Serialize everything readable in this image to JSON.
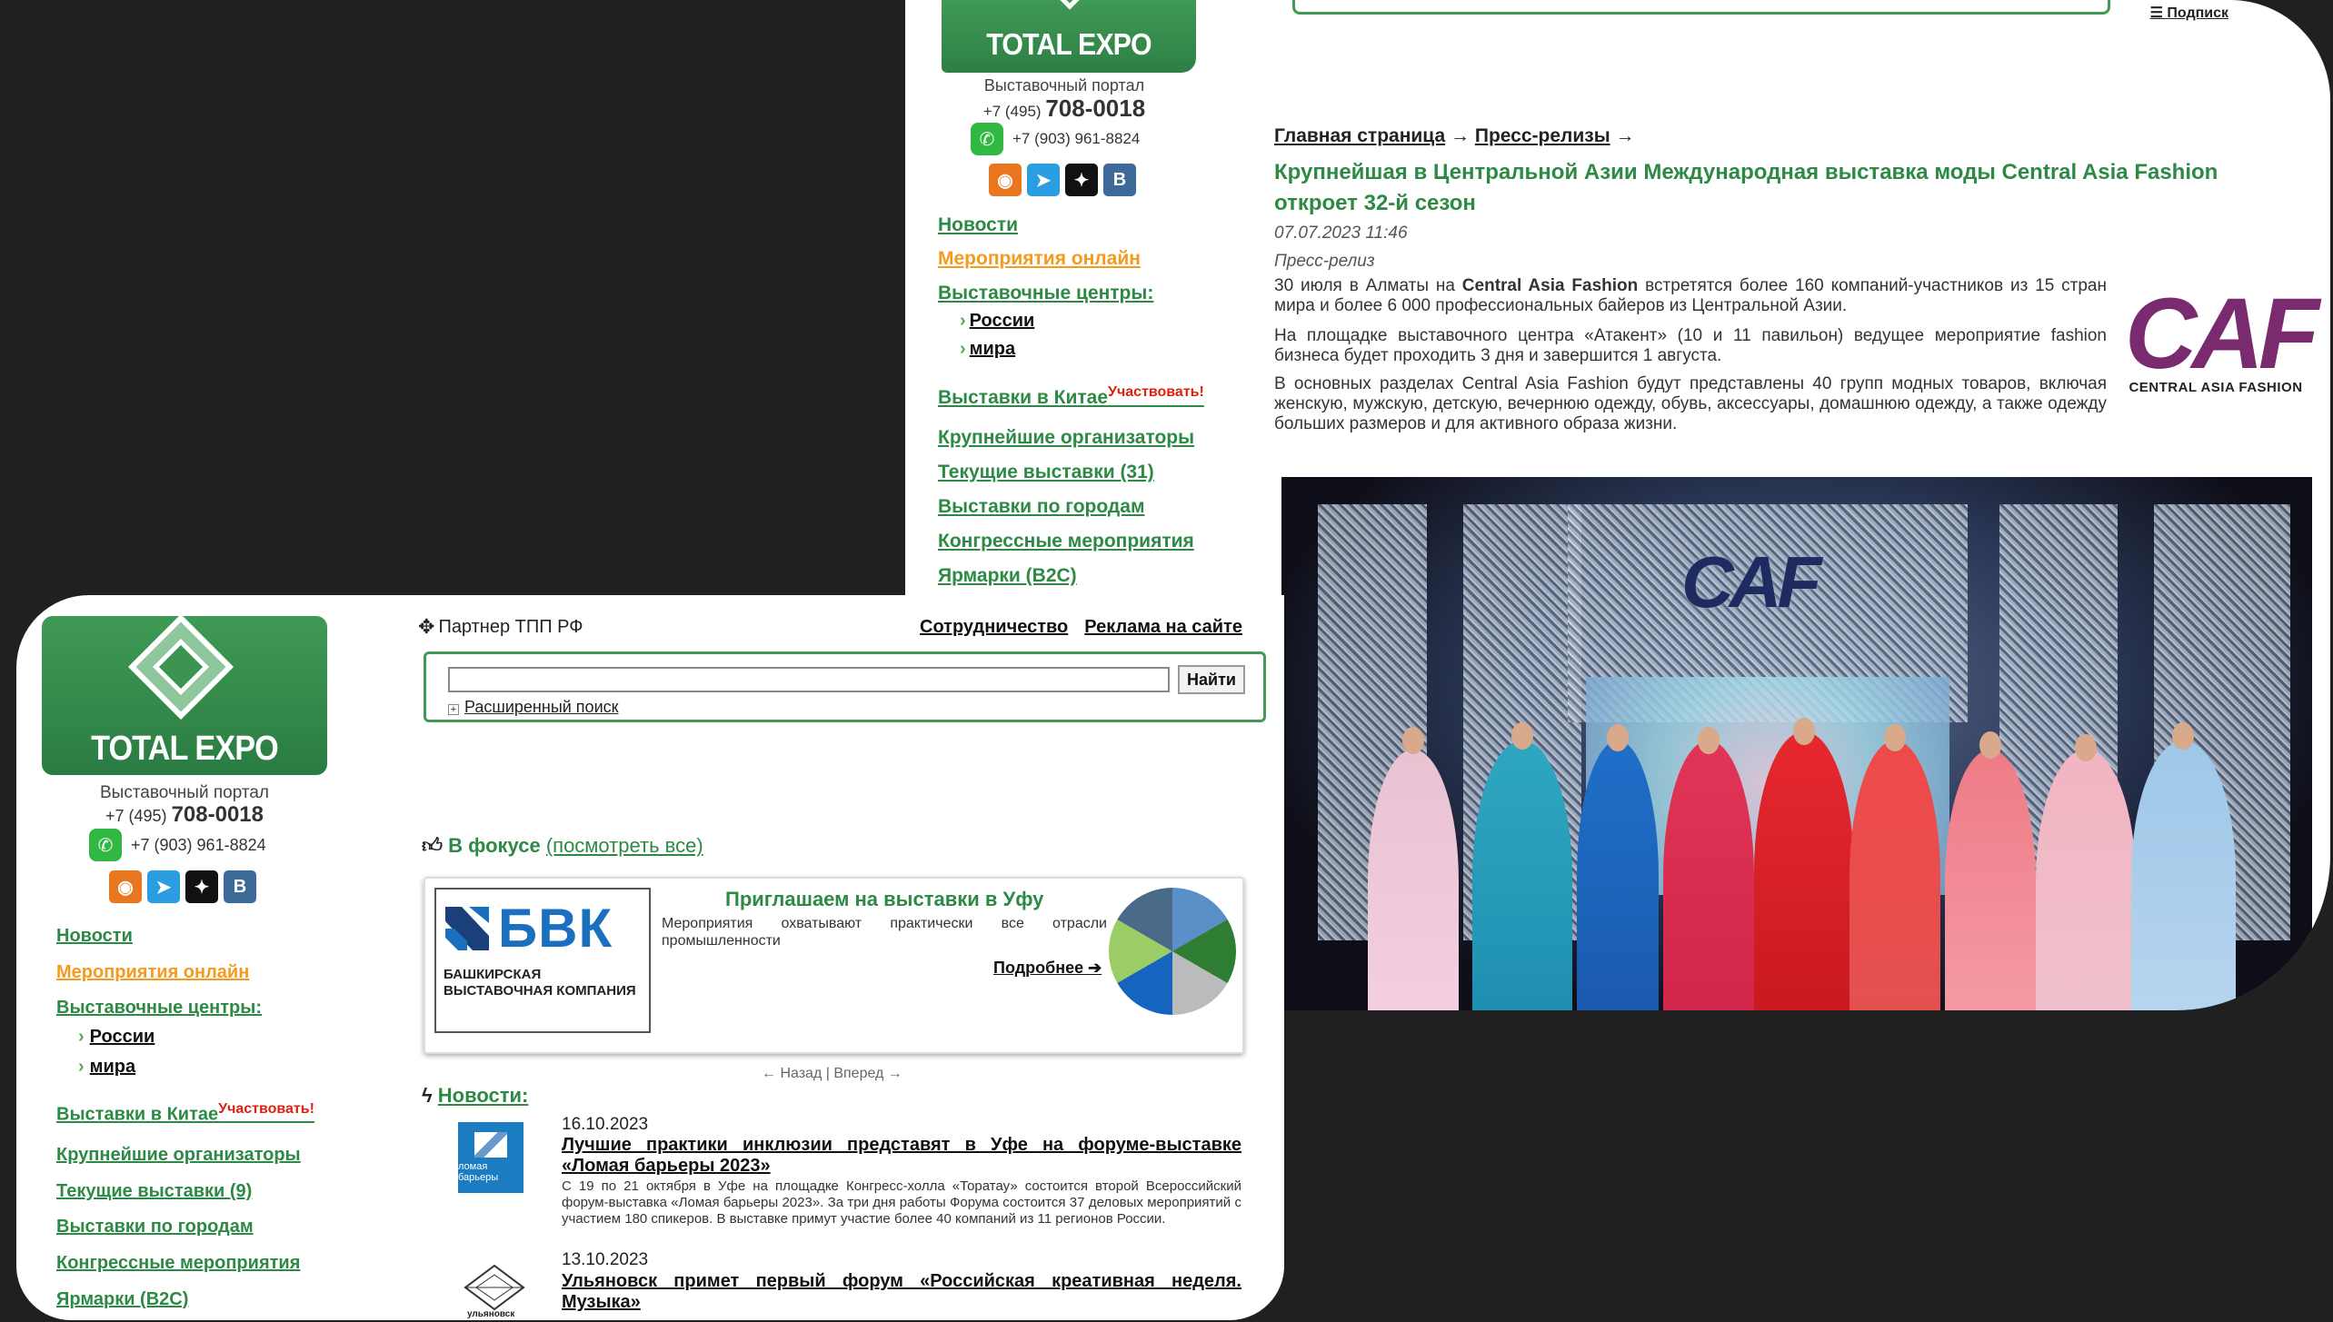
{
  "back": {
    "logo_text": "TOTAL EXPO",
    "portal": "Выставочный портал",
    "phone_prefix": "+7 (495)",
    "phone_main": "708-0018",
    "whatsapp": "+7 (903) 961-8824",
    "subscribe": "Подписк",
    "nav": {
      "news": "Новости",
      "online": "Мероприятия онлайн",
      "centers": "Выставочные центры:",
      "russia": "России",
      "world": "мира",
      "china": "Выставки в Китае",
      "participate": "Участвовать!",
      "organizers": "Крупнейшие организаторы",
      "current": "Текущие выставки (31)",
      "cities": "Выставки по городам",
      "congress": "Конгрессные мероприятия",
      "fairs": "Ярмарки (B2C)"
    },
    "breadcrumbs": {
      "home": "Главная страница",
      "arrow": "→",
      "press": "Пресс-релизы"
    },
    "article": {
      "title": "Крупнейшая в Центральной Азии Международная выставка моды Central Asia Fashion откроет 32-й сезон",
      "date": "07.07.2023 11:46",
      "type": "Пресс-релиз",
      "p1_a": "30 июля в Алматы на ",
      "p1_b": "Central Asia Fashion",
      "p1_c": " встретятся более 160 компаний-участников из 15 стран мира и более 6 000 профессиональных байеров из Центральной Азии.",
      "p2": "На площадке выставочного центра «Атакент» (10 и 11 павильон) ведущее мероприятие fashion бизнеса будет проходить 3 дня и завершится 1 августа.",
      "p3": "В основных разделах Central Asia Fashion будут представлены 40 групп модных товаров, включая женскую, мужскую, детскую, вечернюю одежду, обувь, аксессуары, домашнюю одежду, а также одежду больших размеров и для активного образа жизни.",
      "logo_big": "CAF",
      "logo_small": "CENTRAL ASIA FASHION",
      "stage_logo": "CAF"
    }
  },
  "front": {
    "logo_text": "TOTAL EXPO",
    "portal": "Выставочный портал",
    "phone_prefix": "+7 (495)",
    "phone_main": "708-0018",
    "whatsapp": "+7 (903) 961-8824",
    "partner": "Партнер ТПП РФ",
    "top_links": [
      "Сотрудничество",
      "Реклама на сайте"
    ],
    "search": {
      "value": "",
      "button": "Найти",
      "advanced": "Расширенный поиск"
    },
    "nav": {
      "news": "Новости",
      "online": "Мероприятия онлайн",
      "centers": "Выставочные центры:",
      "russia": "России",
      "world": "мира",
      "china": "Выставки в Китае",
      "participate": "Участвовать!",
      "organizers": "Крупнейшие организаторы",
      "current": "Текущие выставки (9)",
      "cities": "Выставки по городам",
      "congress": "Конгрессные мероприятия",
      "fairs": "Ярмарки (B2C)"
    },
    "focus": {
      "label": "В фокусе",
      "see_all": "(посмотреть все)"
    },
    "banner": {
      "bvk": "БВК",
      "bvk_sub": "БАШКИРСКАЯ ВЫСТАВОЧНАЯ КОМПАНИЯ",
      "title": "Приглашаем на выставки в Уфу",
      "text": "Мероприятия охватывают практически все отрасли промышленности",
      "more": "Подробнее"
    },
    "pager": "← Назад | Вперед →",
    "news_label": "Новости:",
    "news": [
      {
        "date": "16.10.2023",
        "title": "Лучшие практики инклюзии представят в Уфе на форуме-выставке «Ломая барьеры 2023»",
        "text": "С 19 по 21 октября в Уфе на площадке Конгресс-холла «Торатау» состоится второй Всероссийский форум-выставка «Ломая барьеры 2023». За три дня работы Форума состоится 37 деловых мероприятий с участием 180 спикеров. В выставке примут участие более 40 компаний из 11 регионов России.",
        "thumb": "ломая барьеры"
      },
      {
        "date": "13.10.2023",
        "title": "Ульяновск примет первый форум «Российская креативная неделя. Музыка»",
        "thumb": "ульяновск"
      }
    ]
  }
}
